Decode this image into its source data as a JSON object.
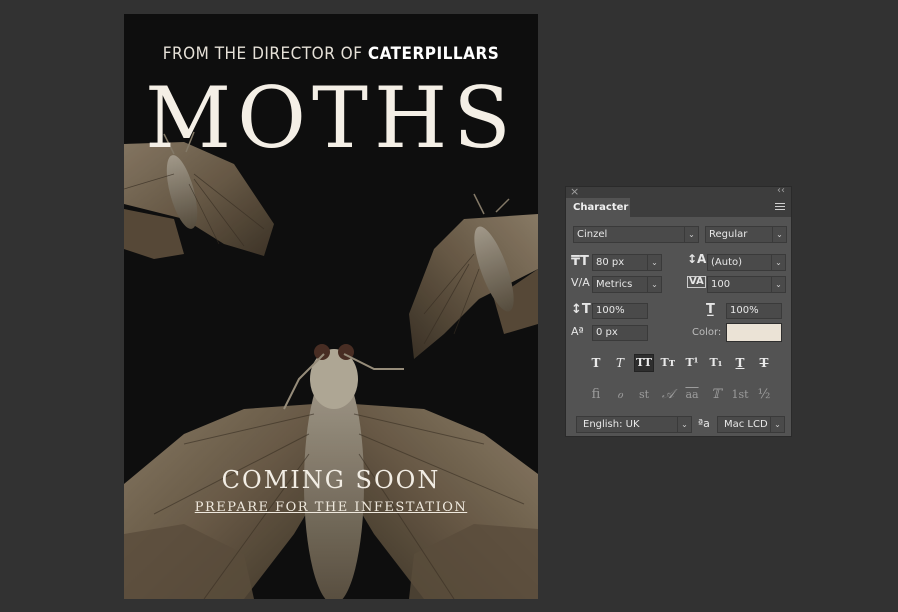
{
  "poster": {
    "tagline_prefix": "FROM THE DIRECTOR OF",
    "tagline_film": "CATERPILLARS",
    "title": "MOTHS",
    "coming": "COMING SOON",
    "prepare": "PREPARE FOR THE INFESTATION"
  },
  "panel": {
    "tab": "Character",
    "font_family": "Cinzel",
    "font_style": "Regular",
    "font_size": "80 px",
    "leading": "(Auto)",
    "kerning": "Metrics",
    "tracking": "100",
    "vertical_scale": "100%",
    "horizontal_scale": "100%",
    "baseline_shift": "0 px",
    "color_label": "Color:",
    "color_value": "#ebe3d6",
    "language": "English: UK",
    "antialias": "Mac LCD",
    "style_buttons": [
      "T",
      "T",
      "TT",
      "Tт",
      "T¹",
      "T₁",
      "T",
      "T"
    ],
    "opentype_buttons": [
      "ﬁ",
      "ℴ",
      "st",
      "𝒜",
      "aa",
      "𝕋",
      "1st",
      "½"
    ]
  },
  "colors": {
    "workspace": "#323232",
    "poster_bg": "#0e0e0e",
    "panel_bg": "#535353",
    "text_color": "#ebe3d6"
  }
}
